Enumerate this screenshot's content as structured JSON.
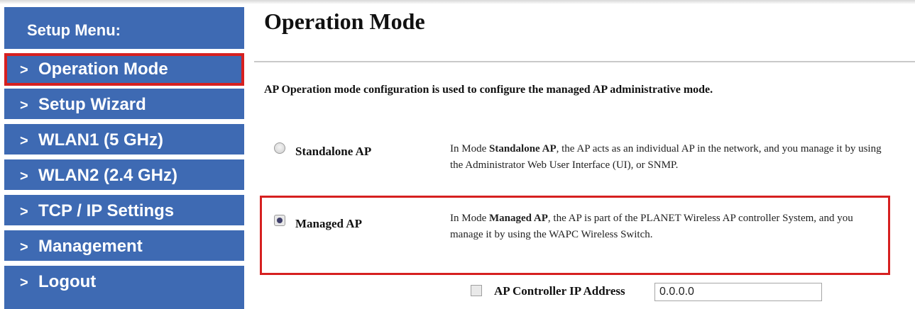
{
  "sidebar": {
    "header": "Setup Menu:",
    "items": [
      {
        "label": "Operation Mode"
      },
      {
        "label": "Setup Wizard"
      },
      {
        "label": "WLAN1 (5 GHz)"
      },
      {
        "label": "WLAN2 (2.4 GHz)"
      },
      {
        "label": "TCP / IP Settings"
      },
      {
        "label": "Management"
      },
      {
        "label": "Logout"
      }
    ],
    "chevron": ">"
  },
  "main": {
    "title": "Operation Mode",
    "intro": "AP Operation mode configuration is used to configure the managed AP administrative mode.",
    "options": [
      {
        "label": "Standalone AP",
        "desc_prefix": "In Mode ",
        "desc_bold": "Standalone AP",
        "desc_rest": ", the AP acts as an individual AP in the network, and you manage it by using the Administrator Web User Interface (UI), or SNMP.",
        "selected": false
      },
      {
        "label": "Managed AP",
        "desc_prefix": "In Mode ",
        "desc_bold": "Managed AP",
        "desc_rest": ", the AP is part of the PLANET Wireless AP controller System, and you manage it by using the WAPC Wireless Switch.",
        "selected": true
      }
    ],
    "controller": {
      "label": "AP Controller IP Address",
      "value": "0.0.0.0",
      "checked": false
    }
  },
  "colors": {
    "sidebar_bg": "#3e6ab3",
    "highlight": "#d62020"
  }
}
